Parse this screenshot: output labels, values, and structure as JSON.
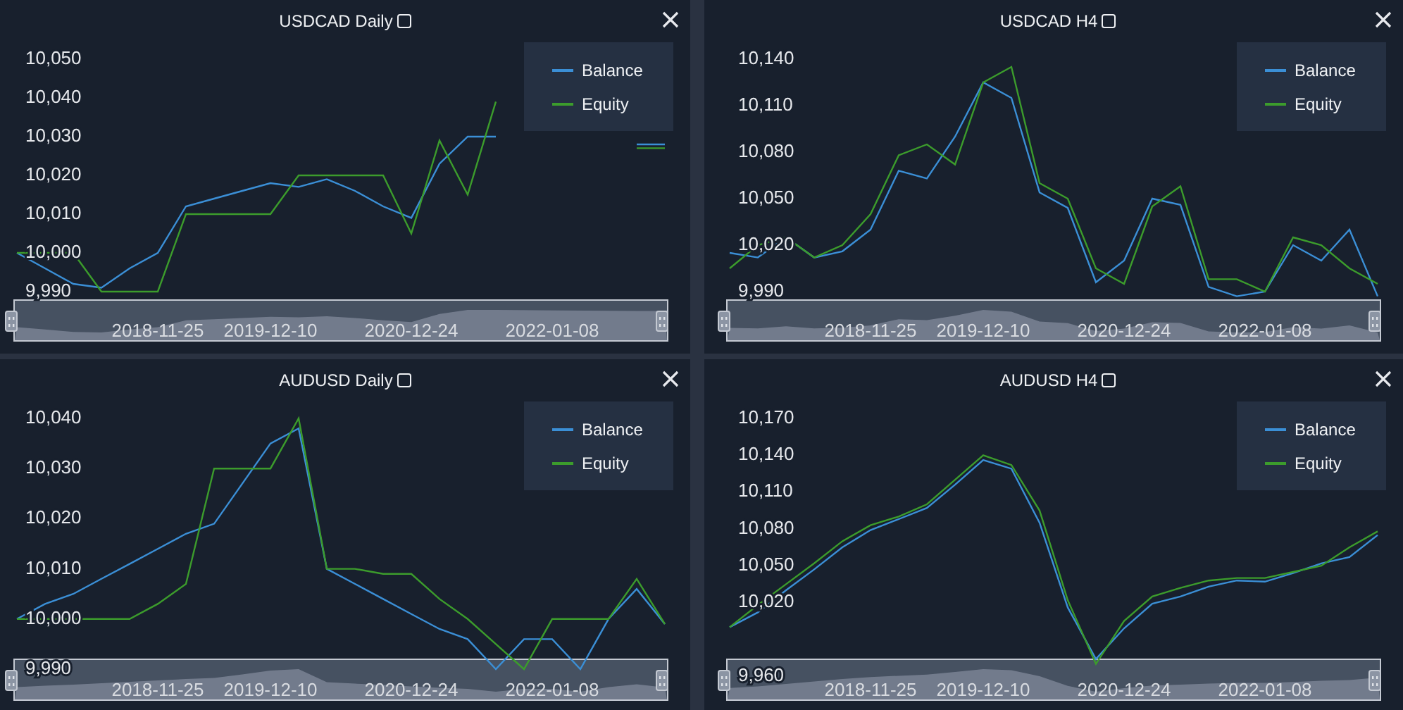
{
  "panels": [
    {
      "title": "USDCAD Daily",
      "chart_data": {
        "type": "line",
        "ylim": [
          9974,
          10065.27
        ],
        "yticks": [
          {
            "value": 9990,
            "label": "9,990"
          },
          {
            "value": 10000,
            "label": "10,000"
          },
          {
            "value": 10010,
            "label": "10,010"
          },
          {
            "value": 10020,
            "label": "10,020"
          },
          {
            "value": 10030,
            "label": "10,030"
          },
          {
            "value": 10040,
            "label": "10,040"
          },
          {
            "value": 10050,
            "label": "10,050"
          }
        ],
        "categories": [
          null,
          null,
          null,
          null,
          null,
          "2018-11-25",
          null,
          null,
          null,
          "2019-12-10",
          null,
          null,
          null,
          null,
          "2020-12-24",
          null,
          null,
          null,
          null,
          "2022-01-08",
          null,
          null,
          null,
          null
        ],
        "series": [
          {
            "name": "Balance",
            "color": "#3b8fd6",
            "values": [
              10000,
              9996,
              9992,
              9991,
              9996,
              10000,
              10012,
              10014,
              10016,
              10018,
              10017,
              10019,
              10016,
              10012,
              10009,
              10023,
              10030,
              10030,
              null,
              null,
              null,
              null,
              10028,
              10028
            ]
          },
          {
            "name": "Equity",
            "color": "#3c9c2c",
            "values": [
              10000,
              10000,
              10000,
              9990,
              9990,
              9990,
              10010,
              10010,
              10010,
              10010,
              10020,
              10020,
              10020,
              10020,
              10005,
              10029,
              10015,
              10039,
              null,
              null,
              null,
              null,
              10027,
              10027
            ]
          }
        ]
      }
    },
    {
      "title": "USDCAD H4",
      "chart_data": {
        "type": "line",
        "ylim": [
          9950,
          10178.18
        ],
        "yticks": [
          {
            "value": 9990,
            "label": "9,990"
          },
          {
            "value": 10020,
            "label": "10,020"
          },
          {
            "value": 10050,
            "label": "10,050"
          },
          {
            "value": 10080,
            "label": "10,080"
          },
          {
            "value": 10110,
            "label": "10,110"
          },
          {
            "value": 10140,
            "label": "10,140"
          }
        ],
        "categories": [
          null,
          null,
          null,
          null,
          null,
          "2018-11-25",
          null,
          null,
          null,
          "2019-12-10",
          null,
          null,
          null,
          null,
          "2020-12-24",
          null,
          null,
          null,
          null,
          "2022-01-08",
          null,
          null,
          null,
          null
        ],
        "series": [
          {
            "name": "Balance",
            "color": "#3b8fd6",
            "values": [
              10015,
              10012,
              10025,
              10012,
              10016,
              10030,
              10068,
              10063,
              10090,
              10125,
              10115,
              10054,
              10044,
              9996,
              10010,
              10050,
              10046,
              9993,
              9987,
              9990,
              10020,
              10010,
              10030,
              9987
            ]
          },
          {
            "name": "Equity",
            "color": "#3c9c2c",
            "values": [
              10005,
              10020,
              10025,
              10012,
              10020,
              10040,
              10078,
              10085,
              10072,
              10125,
              10135,
              10060,
              10050,
              10005,
              9995,
              10045,
              10058,
              9998,
              9998,
              9990,
              10025,
              10020,
              10005,
              9995
            ]
          }
        ]
      }
    },
    {
      "title": "AUDUSD Daily",
      "chart_data": {
        "type": "line",
        "ylim": [
          9981.86,
          10051.8
        ],
        "yticks": [
          {
            "value": 9990,
            "label": "9,990"
          },
          {
            "value": 10000,
            "label": "10,000"
          },
          {
            "value": 10010,
            "label": "10,010"
          },
          {
            "value": 10020,
            "label": "10,020"
          },
          {
            "value": 10030,
            "label": "10,030"
          },
          {
            "value": 10040,
            "label": "10,040"
          }
        ],
        "categories": [
          null,
          null,
          null,
          null,
          null,
          "2018-11-25",
          null,
          null,
          null,
          "2019-12-10",
          null,
          null,
          null,
          null,
          "2020-12-24",
          null,
          null,
          null,
          null,
          "2022-01-08",
          null,
          null,
          null,
          null
        ],
        "series": [
          {
            "name": "Balance",
            "color": "#3b8fd6",
            "values": [
              10000,
              10003,
              10005,
              10008,
              10011,
              10014,
              10017,
              10019,
              10027,
              10035,
              10038,
              10010,
              10007,
              10004,
              10001,
              9998,
              9996,
              9990,
              9996,
              9996,
              9990,
              10000,
              10006,
              9999
            ]
          },
          {
            "name": "Equity",
            "color": "#3c9c2c",
            "values": [
              10000,
              10000,
              10000,
              10000,
              10000,
              10003,
              10007,
              10030,
              10030,
              10030,
              10040,
              10010,
              10010,
              10009,
              10009,
              10004,
              10000,
              9995,
              9990,
              10000,
              10000,
              10000,
              10008,
              9999
            ]
          }
        ]
      }
    },
    {
      "title": "AUDUSD H4",
      "chart_data": {
        "type": "line",
        "ylim": [
          9932.5,
          10218.2
        ],
        "yticks": [
          {
            "value": 9960,
            "label": "9,960"
          },
          {
            "value": 10020,
            "label": "10,020"
          },
          {
            "value": 10050,
            "label": "10,050"
          },
          {
            "value": 10080,
            "label": "10,080"
          },
          {
            "value": 10110,
            "label": "10,110"
          },
          {
            "value": 10140,
            "label": "10,140"
          },
          {
            "value": 10170,
            "label": "10,170"
          }
        ],
        "categories": [
          null,
          null,
          null,
          null,
          null,
          "2018-11-25",
          null,
          null,
          null,
          "2019-12-10",
          null,
          null,
          null,
          null,
          "2020-12-24",
          null,
          null,
          null,
          null,
          "2022-01-08",
          null,
          null,
          null,
          null
        ],
        "series": [
          {
            "name": "Balance",
            "color": "#3b8fd6",
            "values": [
              10000,
              10012,
              10030,
              10047,
              10065,
              10079,
              10088,
              10097,
              10116,
              10136,
              10129,
              10085,
              10016,
              9974,
              9999,
              10019,
              10025,
              10033,
              10038,
              10037,
              10044,
              10052,
              10057,
              10075
            ]
          },
          {
            "name": "Equity",
            "color": "#3c9c2c",
            "values": [
              10000,
              10018,
              10035,
              10052,
              10070,
              10083,
              10090,
              10100,
              10120,
              10140,
              10132,
              10095,
              10022,
              9970,
              10005,
              10025,
              10032,
              10038,
              10040,
              10040,
              10045,
              10050,
              10065,
              10078
            ]
          }
        ]
      }
    }
  ]
}
